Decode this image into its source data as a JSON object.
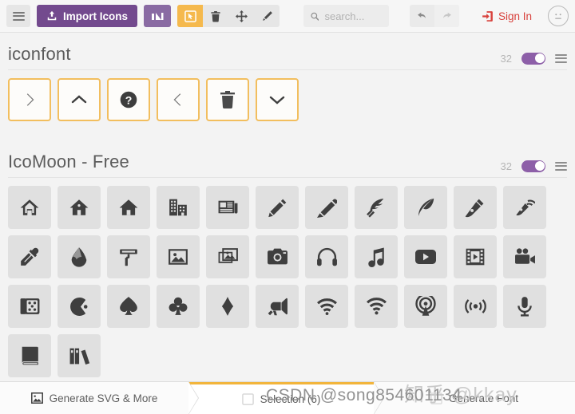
{
  "toolbar": {
    "menu_icon": "hamburger-icon",
    "import_label": "Import Icons",
    "import_icon": "upload-icon",
    "app_icon": "icomoon-logo-icon",
    "tools": [
      {
        "name": "select-tool",
        "icon": "cursor-select-icon",
        "active": true
      },
      {
        "name": "delete-tool",
        "icon": "trash-icon",
        "active": false
      },
      {
        "name": "move-tool",
        "icon": "move-arrows-icon",
        "active": false
      },
      {
        "name": "edit-tool",
        "icon": "pencil-icon",
        "active": false
      }
    ],
    "search": {
      "placeholder": "search...",
      "value": "",
      "icon": "search-icon"
    },
    "undo_icon": "undo-arrow-icon",
    "redo_icon": "redo-arrow-icon",
    "signin_label": "Sign In",
    "signin_icon": "login-icon",
    "avatar_icon": "neutral-face-icon"
  },
  "sets": [
    {
      "title": "iconfont",
      "count": "32",
      "toggle_on": true,
      "menu_icon": "set-menu-icon",
      "icons": [
        {
          "name": "chevron-right-icon",
          "selected": true
        },
        {
          "name": "chevron-up-icon",
          "selected": true
        },
        {
          "name": "question-circle-icon",
          "selected": true
        },
        {
          "name": "chevron-left-icon",
          "selected": true
        },
        {
          "name": "trash-icon",
          "selected": true
        },
        {
          "name": "chevron-down-icon",
          "selected": true
        }
      ]
    },
    {
      "title": "IcoMoon - Free",
      "count": "32",
      "toggle_on": true,
      "menu_icon": "set-menu-icon",
      "icons": [
        {
          "name": "home-icon",
          "selected": false
        },
        {
          "name": "home2-icon",
          "selected": false
        },
        {
          "name": "home3-icon",
          "selected": false
        },
        {
          "name": "office-icon",
          "selected": false
        },
        {
          "name": "newspaper-icon",
          "selected": false
        },
        {
          "name": "pencil-icon",
          "selected": false
        },
        {
          "name": "pencil2-icon",
          "selected": false
        },
        {
          "name": "quill-icon",
          "selected": false
        },
        {
          "name": "feather-pen-icon",
          "selected": false
        },
        {
          "name": "pen-nib-icon",
          "selected": false
        },
        {
          "name": "blog-icon",
          "selected": false
        },
        {
          "name": "eyedropper-icon",
          "selected": false
        },
        {
          "name": "droplet-icon",
          "selected": false
        },
        {
          "name": "paint-roller-icon",
          "selected": false
        },
        {
          "name": "image-icon",
          "selected": false
        },
        {
          "name": "images-icon",
          "selected": false
        },
        {
          "name": "camera-icon",
          "selected": false
        },
        {
          "name": "headphones-icon",
          "selected": false
        },
        {
          "name": "music-icon",
          "selected": false
        },
        {
          "name": "play-icon",
          "selected": false
        },
        {
          "name": "film-icon",
          "selected": false
        },
        {
          "name": "video-camera-icon",
          "selected": false
        },
        {
          "name": "dice-icon",
          "selected": false
        },
        {
          "name": "pacman-icon",
          "selected": false
        },
        {
          "name": "spades-icon",
          "selected": false
        },
        {
          "name": "clubs-icon",
          "selected": false
        },
        {
          "name": "diamonds-icon",
          "selected": false
        },
        {
          "name": "bullhorn-icon",
          "selected": false
        },
        {
          "name": "wifi-icon",
          "selected": false
        },
        {
          "name": "connection-icon",
          "selected": false
        },
        {
          "name": "podcast-icon",
          "selected": false
        },
        {
          "name": "feed-icon",
          "selected": false
        },
        {
          "name": "mic-icon",
          "selected": false
        },
        {
          "name": "book-icon",
          "selected": false
        },
        {
          "name": "books-icon",
          "selected": false
        }
      ]
    }
  ],
  "bottom_tabs": [
    {
      "label": "Generate SVG & More",
      "icon": "image-export-icon",
      "active": false
    },
    {
      "label": "Selection (6)",
      "icon": "selection-icon",
      "active": true
    },
    {
      "label": "Generate Font",
      "icon": "font-icon",
      "active": false
    }
  ],
  "watermarks": {
    "csdn": "CSDN @song854601134",
    "zhihu": "知乎 @kkay"
  },
  "colors": {
    "purple": "#734a8e",
    "orange": "#f2b53c",
    "red": "#d8413c",
    "toggle_on": "#8d5fa8"
  }
}
